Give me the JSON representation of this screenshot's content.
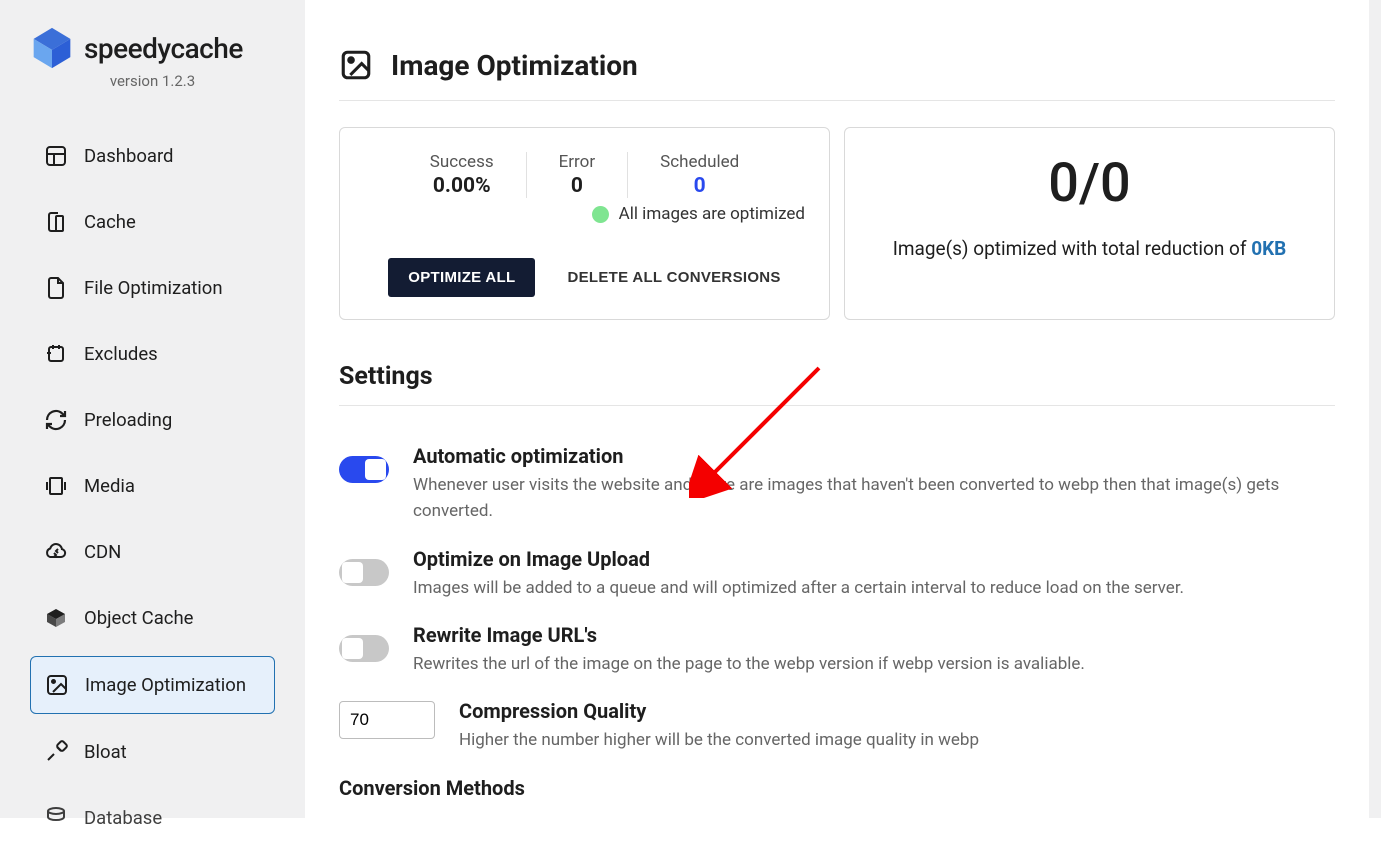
{
  "brand": {
    "name": "speedycache",
    "version": "version 1.2.3"
  },
  "sidebar": {
    "items": [
      {
        "label": "Dashboard"
      },
      {
        "label": "Cache"
      },
      {
        "label": "File Optimization"
      },
      {
        "label": "Excludes"
      },
      {
        "label": "Preloading"
      },
      {
        "label": "Media"
      },
      {
        "label": "CDN"
      },
      {
        "label": "Object Cache"
      },
      {
        "label": "Image Optimization"
      },
      {
        "label": "Bloat"
      },
      {
        "label": "Database"
      }
    ]
  },
  "page": {
    "title": "Image Optimization"
  },
  "stats": {
    "success": {
      "label": "Success",
      "value": "0.00%"
    },
    "error": {
      "label": "Error",
      "value": "0"
    },
    "scheduled": {
      "label": "Scheduled",
      "value": "0"
    },
    "status_text": "All images are optimized",
    "optimize_btn": "OPTIMIZE ALL",
    "delete_btn": "DELETE ALL CONVERSIONS",
    "fraction": "0/0",
    "reduction_prefix": "Image(s) optimized with total reduction of ",
    "reduction_value": "0KB"
  },
  "settings": {
    "heading": "Settings",
    "auto": {
      "title": "Automatic optimization",
      "desc": "Whenever user visits the website and there are images that haven't been converted to webp then that image(s) gets converted.",
      "on": true
    },
    "upload": {
      "title": "Optimize on Image Upload",
      "desc": "Images will be added to a queue and will optimized after a certain interval to reduce load on the server.",
      "on": false
    },
    "rewrite": {
      "title": "Rewrite Image URL's",
      "desc": "Rewrites the url of the image on the page to the webp version if webp version is avaliable.",
      "on": false
    },
    "quality": {
      "title": "Compression Quality",
      "desc": "Higher the number higher will be the converted image quality in webp",
      "value": "70"
    },
    "conversion_heading": "Conversion Methods"
  }
}
